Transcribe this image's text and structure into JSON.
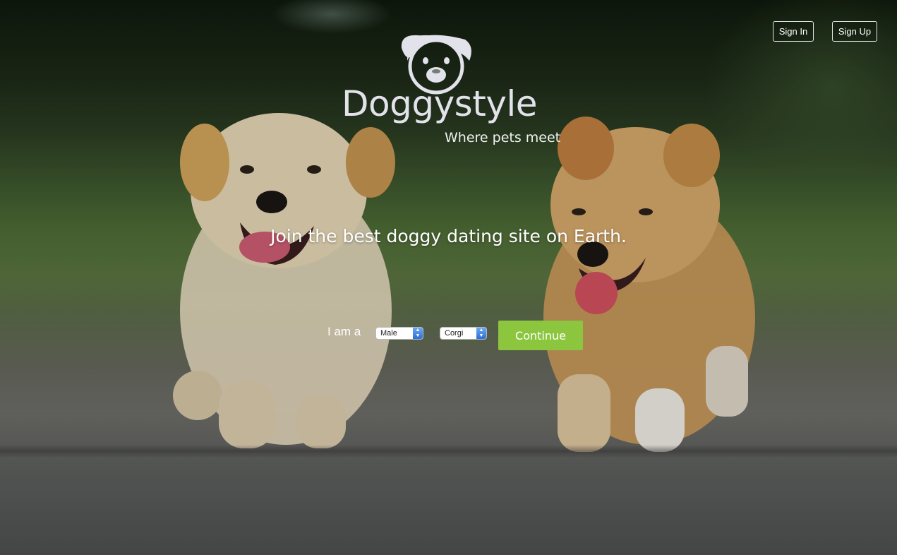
{
  "nav": {
    "signin_label": "Sign In",
    "signup_label": "Sign Up"
  },
  "brand": {
    "name": "Doggystyle",
    "tagline": "Where pets meet",
    "logo_icon": "dog-face-icon"
  },
  "hero": {
    "headline": "Join the best doggy dating site on Earth."
  },
  "form": {
    "iam_label": "I am a",
    "sex_value": "Male",
    "breed_value": "Corgi",
    "continue_label": "Continue"
  },
  "colors": {
    "accent": "#8cc63f",
    "text": "#ffffff",
    "logo": "#e2e2ea"
  }
}
